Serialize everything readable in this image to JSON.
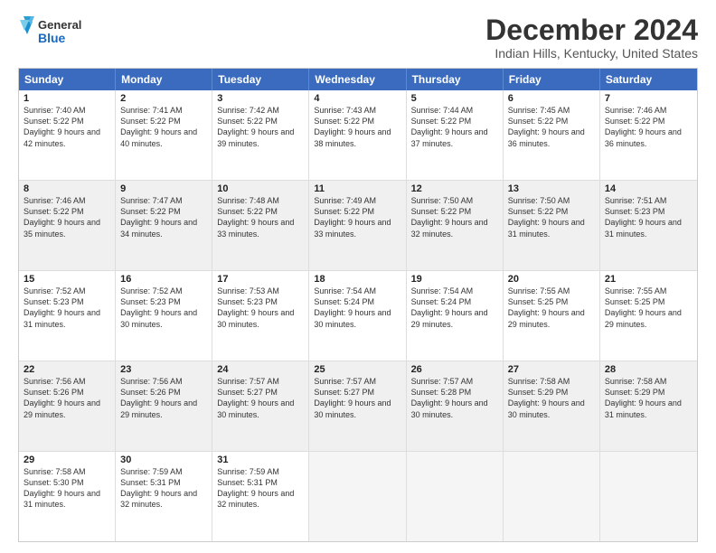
{
  "header": {
    "logo_general": "General",
    "logo_blue": "Blue",
    "main_title": "December 2024",
    "subtitle": "Indian Hills, Kentucky, United States"
  },
  "days_of_week": [
    "Sunday",
    "Monday",
    "Tuesday",
    "Wednesday",
    "Thursday",
    "Friday",
    "Saturday"
  ],
  "weeks": [
    [
      {
        "day": "1",
        "info": "Sunrise: 7:40 AM\nSunset: 5:22 PM\nDaylight: 9 hours and 42 minutes."
      },
      {
        "day": "2",
        "info": "Sunrise: 7:41 AM\nSunset: 5:22 PM\nDaylight: 9 hours and 40 minutes."
      },
      {
        "day": "3",
        "info": "Sunrise: 7:42 AM\nSunset: 5:22 PM\nDaylight: 9 hours and 39 minutes."
      },
      {
        "day": "4",
        "info": "Sunrise: 7:43 AM\nSunset: 5:22 PM\nDaylight: 9 hours and 38 minutes."
      },
      {
        "day": "5",
        "info": "Sunrise: 7:44 AM\nSunset: 5:22 PM\nDaylight: 9 hours and 37 minutes."
      },
      {
        "day": "6",
        "info": "Sunrise: 7:45 AM\nSunset: 5:22 PM\nDaylight: 9 hours and 36 minutes."
      },
      {
        "day": "7",
        "info": "Sunrise: 7:46 AM\nSunset: 5:22 PM\nDaylight: 9 hours and 36 minutes."
      }
    ],
    [
      {
        "day": "8",
        "info": "Sunrise: 7:46 AM\nSunset: 5:22 PM\nDaylight: 9 hours and 35 minutes."
      },
      {
        "day": "9",
        "info": "Sunrise: 7:47 AM\nSunset: 5:22 PM\nDaylight: 9 hours and 34 minutes."
      },
      {
        "day": "10",
        "info": "Sunrise: 7:48 AM\nSunset: 5:22 PM\nDaylight: 9 hours and 33 minutes."
      },
      {
        "day": "11",
        "info": "Sunrise: 7:49 AM\nSunset: 5:22 PM\nDaylight: 9 hours and 33 minutes."
      },
      {
        "day": "12",
        "info": "Sunrise: 7:50 AM\nSunset: 5:22 PM\nDaylight: 9 hours and 32 minutes."
      },
      {
        "day": "13",
        "info": "Sunrise: 7:50 AM\nSunset: 5:22 PM\nDaylight: 9 hours and 31 minutes."
      },
      {
        "day": "14",
        "info": "Sunrise: 7:51 AM\nSunset: 5:23 PM\nDaylight: 9 hours and 31 minutes."
      }
    ],
    [
      {
        "day": "15",
        "info": "Sunrise: 7:52 AM\nSunset: 5:23 PM\nDaylight: 9 hours and 31 minutes."
      },
      {
        "day": "16",
        "info": "Sunrise: 7:52 AM\nSunset: 5:23 PM\nDaylight: 9 hours and 30 minutes."
      },
      {
        "day": "17",
        "info": "Sunrise: 7:53 AM\nSunset: 5:23 PM\nDaylight: 9 hours and 30 minutes."
      },
      {
        "day": "18",
        "info": "Sunrise: 7:54 AM\nSunset: 5:24 PM\nDaylight: 9 hours and 30 minutes."
      },
      {
        "day": "19",
        "info": "Sunrise: 7:54 AM\nSunset: 5:24 PM\nDaylight: 9 hours and 29 minutes."
      },
      {
        "day": "20",
        "info": "Sunrise: 7:55 AM\nSunset: 5:25 PM\nDaylight: 9 hours and 29 minutes."
      },
      {
        "day": "21",
        "info": "Sunrise: 7:55 AM\nSunset: 5:25 PM\nDaylight: 9 hours and 29 minutes."
      }
    ],
    [
      {
        "day": "22",
        "info": "Sunrise: 7:56 AM\nSunset: 5:26 PM\nDaylight: 9 hours and 29 minutes."
      },
      {
        "day": "23",
        "info": "Sunrise: 7:56 AM\nSunset: 5:26 PM\nDaylight: 9 hours and 29 minutes."
      },
      {
        "day": "24",
        "info": "Sunrise: 7:57 AM\nSunset: 5:27 PM\nDaylight: 9 hours and 30 minutes."
      },
      {
        "day": "25",
        "info": "Sunrise: 7:57 AM\nSunset: 5:27 PM\nDaylight: 9 hours and 30 minutes."
      },
      {
        "day": "26",
        "info": "Sunrise: 7:57 AM\nSunset: 5:28 PM\nDaylight: 9 hours and 30 minutes."
      },
      {
        "day": "27",
        "info": "Sunrise: 7:58 AM\nSunset: 5:29 PM\nDaylight: 9 hours and 30 minutes."
      },
      {
        "day": "28",
        "info": "Sunrise: 7:58 AM\nSunset: 5:29 PM\nDaylight: 9 hours and 31 minutes."
      }
    ],
    [
      {
        "day": "29",
        "info": "Sunrise: 7:58 AM\nSunset: 5:30 PM\nDaylight: 9 hours and 31 minutes."
      },
      {
        "day": "30",
        "info": "Sunrise: 7:59 AM\nSunset: 5:31 PM\nDaylight: 9 hours and 32 minutes."
      },
      {
        "day": "31",
        "info": "Sunrise: 7:59 AM\nSunset: 5:31 PM\nDaylight: 9 hours and 32 minutes."
      },
      {
        "day": "",
        "info": ""
      },
      {
        "day": "",
        "info": ""
      },
      {
        "day": "",
        "info": ""
      },
      {
        "day": "",
        "info": ""
      }
    ]
  ]
}
